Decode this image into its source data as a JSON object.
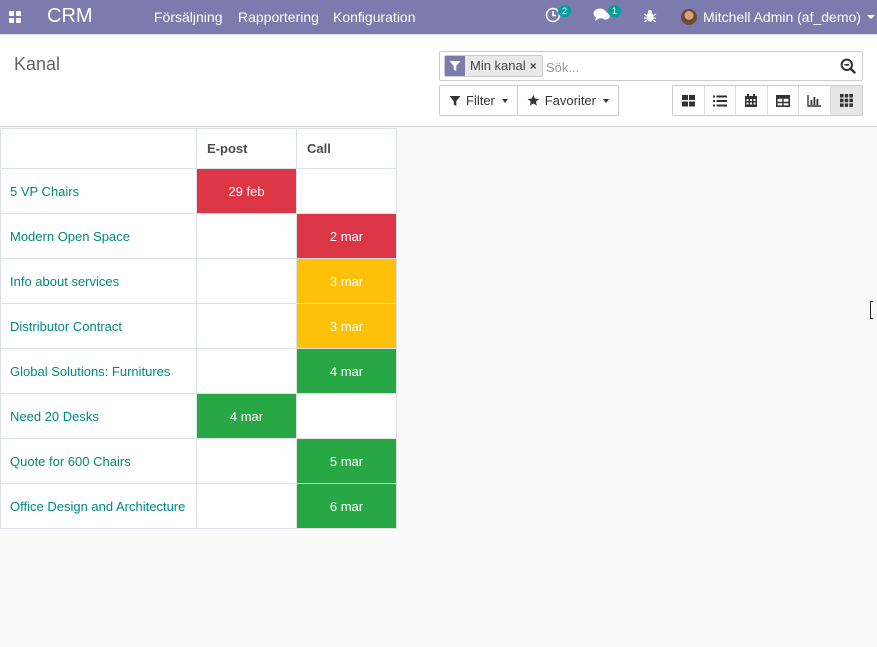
{
  "navbar": {
    "brand": "CRM",
    "menu": [
      "Försäljning",
      "Rapportering",
      "Konfiguration"
    ],
    "activity_count": "2",
    "messages_count": "1",
    "user_name": "Mitchell Admin (af_demo)"
  },
  "control_panel": {
    "title": "Kanal",
    "search": {
      "facet_label": "Min kanal",
      "placeholder": "Sök..."
    },
    "filter_label": "Filter",
    "favorites_label": "Favoriter",
    "views": [
      "kanban",
      "list",
      "calendar",
      "pivot",
      "graph",
      "activity"
    ],
    "active_view": "activity"
  },
  "activity": {
    "columns": [
      "E-post",
      "Call"
    ],
    "rows": [
      {
        "name": "5 VP Chairs",
        "cells": [
          {
            "text": "29 feb",
            "color": "red"
          },
          null
        ]
      },
      {
        "name": "Modern Open Space",
        "cells": [
          null,
          {
            "text": "2 mar",
            "color": "red"
          }
        ]
      },
      {
        "name": "Info about services",
        "cells": [
          null,
          {
            "text": "3 mar",
            "color": "orange"
          }
        ]
      },
      {
        "name": "Distributor Contract",
        "cells": [
          null,
          {
            "text": "3 mar",
            "color": "orange"
          }
        ]
      },
      {
        "name": "Global Solutions: Furnitures",
        "cells": [
          null,
          {
            "text": "4 mar",
            "color": "green"
          }
        ]
      },
      {
        "name": "Need 20 Desks",
        "cells": [
          {
            "text": "4 mar",
            "color": "green"
          },
          null
        ]
      },
      {
        "name": "Quote for 600 Chairs",
        "cells": [
          null,
          {
            "text": "5 mar",
            "color": "green"
          }
        ]
      },
      {
        "name": "Office Design and Architecture",
        "cells": [
          null,
          {
            "text": "6 mar",
            "color": "green"
          }
        ]
      }
    ]
  },
  "colors": {
    "navbar": "#7c7bad",
    "link": "#008784",
    "overdue": "#dc3545",
    "today": "#ffc107",
    "planned": "#28a745"
  }
}
